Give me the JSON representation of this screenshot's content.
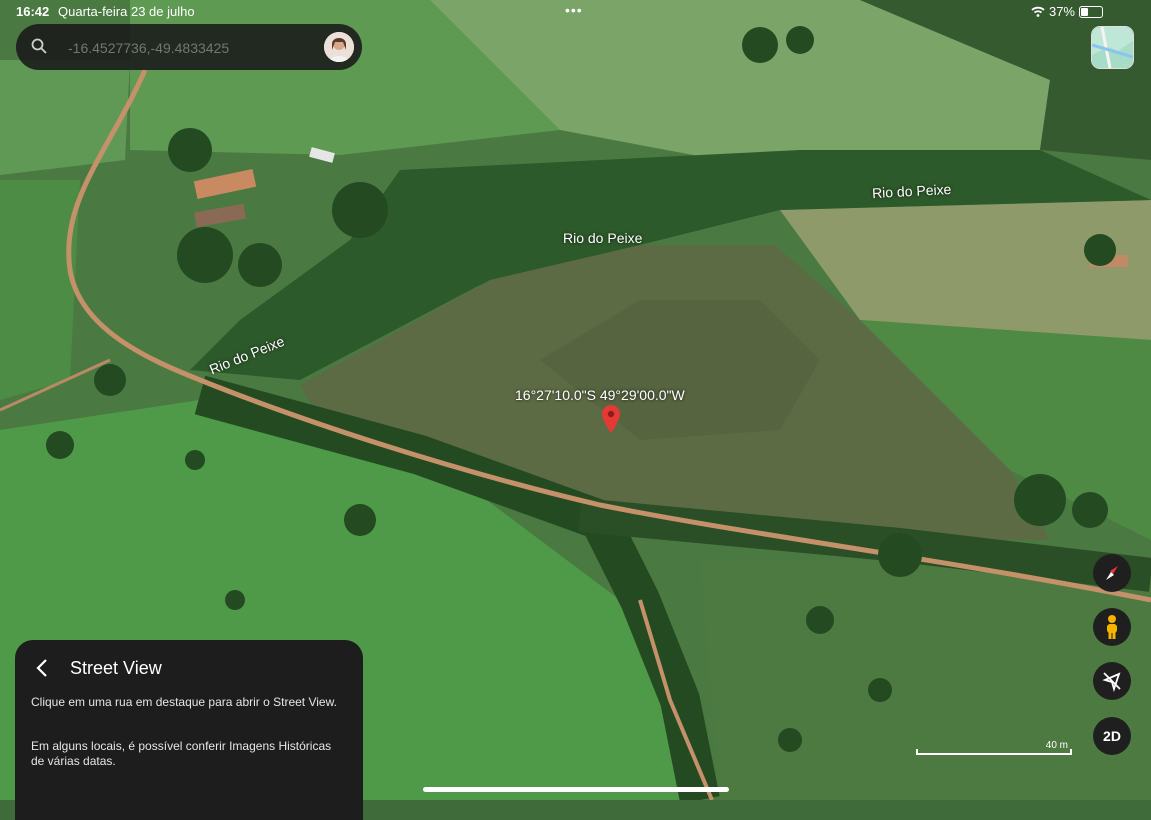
{
  "status_bar": {
    "time": "16:42",
    "date": "Quarta-feira 23 de julho",
    "battery": "37%",
    "battery_level": 0.37
  },
  "search": {
    "placeholder": "-16.4527736,-49.4833425",
    "icon": "search-icon"
  },
  "map": {
    "labels": [
      "Rio do Peixe",
      "Rio do Peixe",
      "Rio do Peixe"
    ],
    "pin_coordinates": "16°27'10.0\"S 49°29'00.0\"W",
    "pin_color": "#e53935",
    "scale_label": "40 m"
  },
  "controls": {
    "compass": "compass-icon",
    "street_view": "pegman-icon",
    "location": "location-off-icon",
    "view_mode": "2D"
  },
  "panel": {
    "title": "Street View",
    "text1": "Clique em uma rua em destaque para abrir o Street View.",
    "text2": "Em alguns locais, é possível conferir Imagens Históricas de várias datas."
  }
}
